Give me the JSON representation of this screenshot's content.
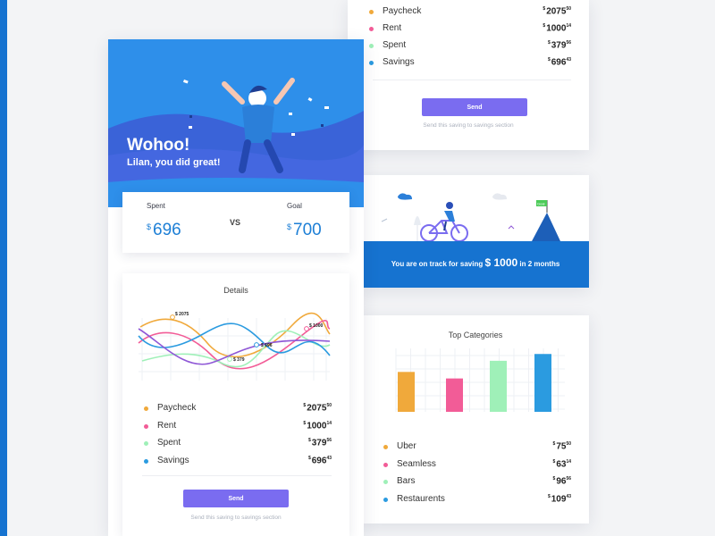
{
  "hero": {
    "title": "Wohoo!",
    "subtitle": "Lilan, you did great!"
  },
  "stats": {
    "spent_label": "Spent",
    "spent_currency": "$",
    "spent_value": "696",
    "vs": "VS",
    "goal_label": "Goal",
    "goal_currency": "$",
    "goal_value": "700"
  },
  "details": {
    "title": "Details",
    "annotations": [
      "$ 2075",
      "$ 1000",
      "$ 696",
      "$ 379"
    ],
    "items": [
      {
        "label": "Paycheck",
        "currency": "$",
        "whole": "2075",
        "cents": "50",
        "color": "#f0a93b"
      },
      {
        "label": "Rent",
        "currency": "$",
        "whole": "1000",
        "cents": "14",
        "color": "#f25c97"
      },
      {
        "label": "Spent",
        "currency": "$",
        "whole": "379",
        "cents": "56",
        "color": "#9ff0b8"
      },
      {
        "label": "Savings",
        "currency": "$",
        "whole": "696",
        "cents": "43",
        "color": "#2b9be0"
      }
    ],
    "send_label": "Send",
    "send_note": "Send this saving to savings section"
  },
  "top_right": {
    "items": [
      {
        "label": "Paycheck",
        "currency": "$",
        "whole": "2075",
        "cents": "50",
        "color": "#f0a93b"
      },
      {
        "label": "Rent",
        "currency": "$",
        "whole": "1000",
        "cents": "14",
        "color": "#f25c97"
      },
      {
        "label": "Spent",
        "currency": "$",
        "whole": "379",
        "cents": "56",
        "color": "#9ff0b8"
      },
      {
        "label": "Savings",
        "currency": "$",
        "whole": "696",
        "cents": "43",
        "color": "#2b9be0"
      }
    ],
    "send_label": "Send",
    "send_note": "Send this saving to savings section"
  },
  "track": {
    "flag_label": "Goal",
    "prefix": "You are on track for saving",
    "amount": "$ 1000",
    "suffix": "in 2 months"
  },
  "categories": {
    "title": "Top Categories",
    "items": [
      {
        "label": "Uber",
        "currency": "$",
        "whole": "75",
        "cents": "50",
        "color": "#f0a93b"
      },
      {
        "label": "Seamless",
        "currency": "$",
        "whole": "63",
        "cents": "14",
        "color": "#f25c97"
      },
      {
        "label": "Bars",
        "currency": "$",
        "whole": "96",
        "cents": "56",
        "color": "#9ff0b8"
      },
      {
        "label": "Restaurents",
        "currency": "$",
        "whole": "109",
        "cents": "43",
        "color": "#2b9be0"
      }
    ]
  },
  "chart_data": [
    {
      "type": "line",
      "title": "Details",
      "series": [
        {
          "name": "Paycheck",
          "color": "#f0a93b"
        },
        {
          "name": "Rent",
          "color": "#f25c97"
        },
        {
          "name": "Spent",
          "color": "#9ff0b8"
        },
        {
          "name": "Savings",
          "color": "#2b9be0"
        }
      ],
      "annotations": [
        "$ 2075",
        "$ 1000",
        "$ 696",
        "$ 379"
      ]
    },
    {
      "type": "bar",
      "title": "Top Categories",
      "categories": [
        "Uber",
        "Seamless",
        "Bars",
        "Restaurents"
      ],
      "values": [
        75.5,
        63.14,
        96.56,
        109.43
      ],
      "colors": [
        "#f0a93b",
        "#f25c97",
        "#9ff0b8",
        "#2b9be0"
      ]
    }
  ]
}
